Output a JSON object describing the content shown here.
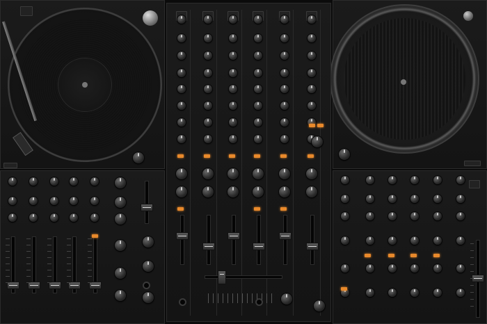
{
  "accent_color": "#e8892b",
  "left_deck": {
    "brand": "",
    "icon": "turntable-icon"
  },
  "right_deck": {
    "brand": "",
    "icon": "turntable-icon"
  },
  "mixer": {
    "channels": 6
  },
  "fx_panel": {
    "channels": 6
  }
}
